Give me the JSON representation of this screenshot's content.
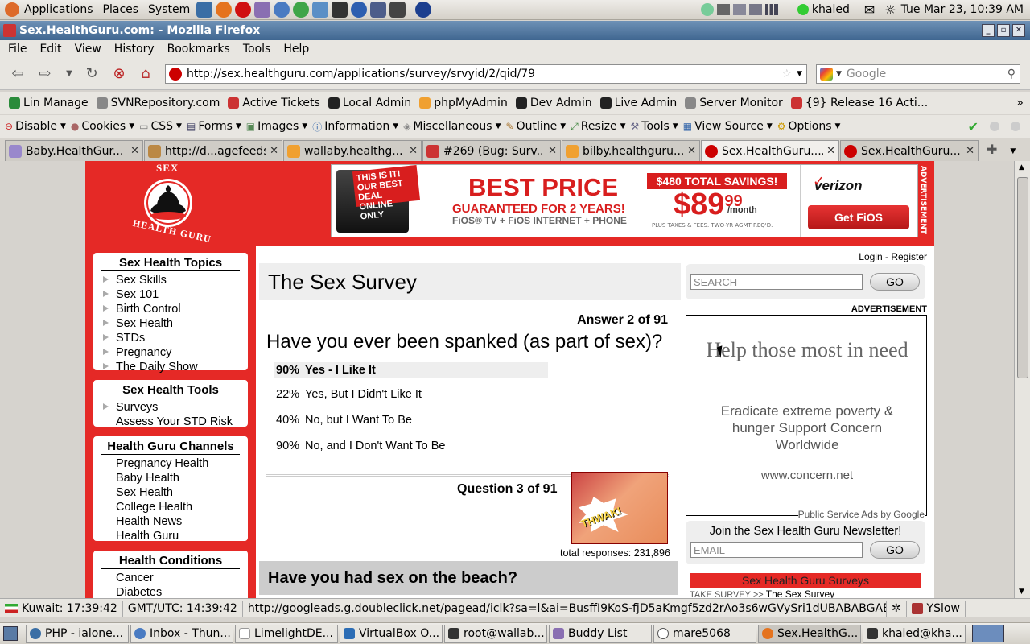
{
  "panel": {
    "menus": [
      "Applications",
      "Places",
      "System"
    ],
    "user": "khaled",
    "datetime": "Tue Mar 23, 10:39 AM"
  },
  "window": {
    "title": "Sex.HealthGuru.com: - Mozilla Firefox"
  },
  "menubar": [
    "File",
    "Edit",
    "View",
    "History",
    "Bookmarks",
    "Tools",
    "Help"
  ],
  "nav": {
    "url": "http://sex.healthguru.com/applications/survey/srvyid/2/qid/79",
    "search_placeholder": "Google"
  },
  "bookmarks": [
    "Lin Manage",
    "SVNRepository.com",
    "Active Tickets",
    "Local Admin",
    "phpMyAdmin",
    "Dev Admin",
    "Live Admin",
    "Server Monitor",
    "{9} Release 16 Acti..."
  ],
  "webdev": [
    "Disable",
    "Cookies",
    "CSS",
    "Forms",
    "Images",
    "Information",
    "Miscellaneous",
    "Outline",
    "Resize",
    "Tools",
    "View Source",
    "Options"
  ],
  "tabs": [
    "Baby.HealthGur...",
    "http://d...agefeeds",
    "wallaby.healthg...",
    "#269 (Bug: Surv...",
    "bilby.healthguru...",
    "Sex.HealthGuru....",
    "Sex.HealthGuru...."
  ],
  "banner": {
    "tag1": "THIS IS IT!",
    "tag2": "OUR BEST DEAL ONLINE ONLY",
    "headline": "BEST PRICE",
    "sub": "GUARANTEED FOR 2 YEARS!",
    "products": "FiOS® TV + FiOS INTERNET + PHONE",
    "savings": "$480 TOTAL SAVINGS!",
    "price": "$89",
    "cents": "99",
    "per": "/month",
    "fine": "PLUS TAXES & FEES. TWO-YR AGMT REQ'D.",
    "brand": "verizon",
    "cta": "Get FiOS",
    "vertical": "ADVERTISEMENT"
  },
  "logo": {
    "top": "SEX",
    "bottom": "HEALTH GURU"
  },
  "sidebar": {
    "topics_title": "Sex Health Topics",
    "topics": [
      "Sex Skills",
      "Sex 101",
      "Birth Control",
      "Sex Health",
      "STDs",
      "Pregnancy",
      "The Daily Show"
    ],
    "tools_title": "Sex Health Tools",
    "tools": [
      "Surveys",
      "Assess Your STD Risk"
    ],
    "channels_title": "Health Guru Channels",
    "channels": [
      "Pregnancy Health",
      "Baby Health",
      "Sex Health",
      "College Health",
      "Health News",
      "Health Guru"
    ],
    "conditions_title": "Health Conditions",
    "conditions": [
      "Cancer",
      "Diabetes"
    ]
  },
  "survey": {
    "title": "The Sex Survey",
    "answer_label": "Answer 2 of 91",
    "question": "Have you ever been spanked (as part of sex)?",
    "options": [
      {
        "pct": "90%",
        "label": "Yes - I Like It",
        "highlight": true
      },
      {
        "pct": "22%",
        "label": "Yes, But I Didn't Like It"
      },
      {
        "pct": "40%",
        "label": "No, but I Want To Be"
      },
      {
        "pct": "90%",
        "label": "No, and I Don't Want To Be"
      }
    ],
    "next_label": "Question 3 of 91",
    "thumb_text": "THWAK!",
    "total_responses": "total responses: 231,896",
    "next_question": "Have you had sex on the beach?"
  },
  "right": {
    "login": "Login",
    "register": "Register",
    "search_placeholder": "SEARCH",
    "go": "GO",
    "ad_label": "ADVERTISEMENT",
    "ad_headline": "Help those most in need",
    "ad_body": "Eradicate extreme poverty & hunger Support Concern Worldwide",
    "ad_url": "www.concern.net",
    "ad_footer": "Public Service Ads by Google",
    "newsletter_title": "Join the Sex Health Guru Newsletter!",
    "email_placeholder": "EMAIL",
    "surveys_heading": "Sex Health Guru Surveys",
    "take_survey": "TAKE SURVEY >>",
    "take_survey_link": "The Sex Survey"
  },
  "status": {
    "kuwait": "Kuwait: 17:39:42",
    "gmt": "GMT/UTC: 14:39:42",
    "url": "http://googleads.g.doubleclick.net/pagead/iclk?sa=l&ai=BusffI9KoS-fjD5aKmgf5zd2rAo3s6wGVySri1dUBABABGAEgA...",
    "yslow": "YSlow"
  },
  "taskbar": [
    "PHP - ialone...",
    "Inbox - Thun...",
    "LimelightDE...",
    "VirtualBox O...",
    "root@wallab...",
    "Buddy List",
    "mare5068",
    "Sex.HealthG...",
    "khaled@kha..."
  ]
}
